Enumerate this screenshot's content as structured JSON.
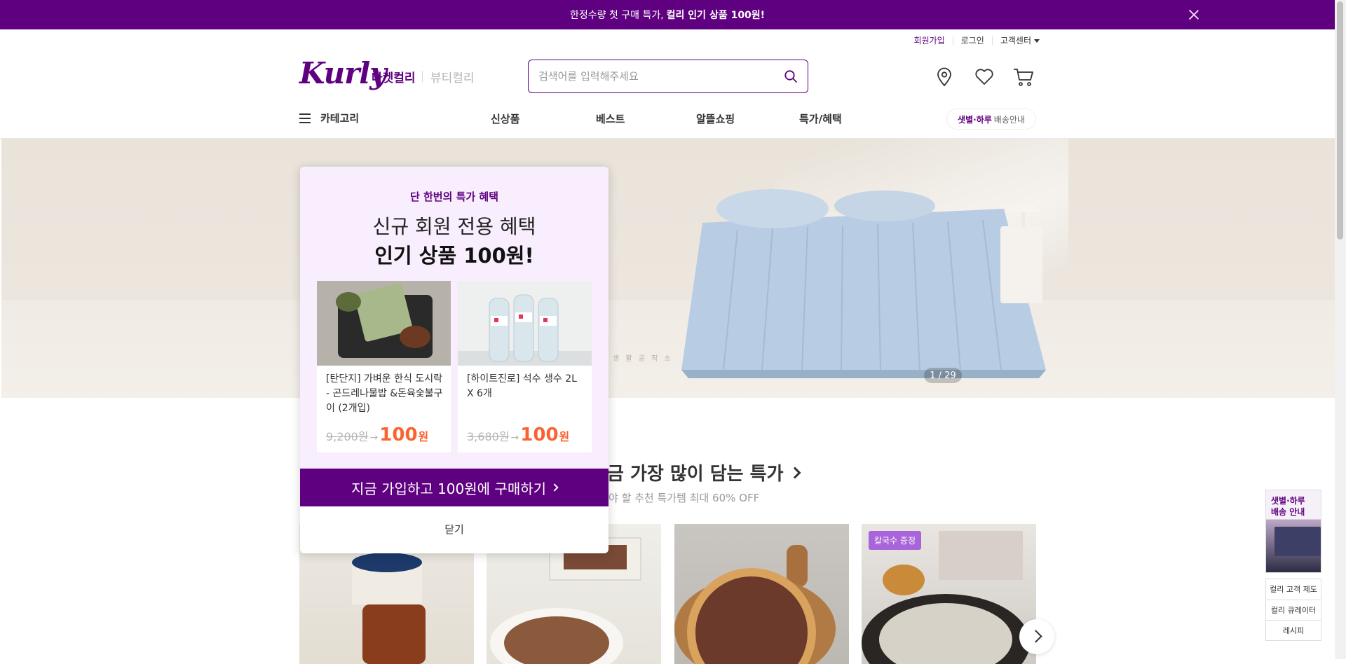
{
  "topbar": {
    "text": "한정수량 첫 구매 특가,",
    "bold": "컬리 인기 상품 100원!"
  },
  "usermenu": {
    "signup": "회원가입",
    "login": "로그인",
    "support": "고객센터"
  },
  "header": {
    "logo": "Kurly",
    "tab_market": "마켓컬리",
    "tab_beauty": "뷰티컬리",
    "search_placeholder": "검색어를 입력해주세요"
  },
  "gnb": {
    "category": "카테고리",
    "items": [
      "신상품",
      "베스트",
      "알뜰쇼핑",
      "특가/혜택"
    ],
    "delivery_bold": "샛별·하루",
    "delivery_rest": "배송안내"
  },
  "hero": {
    "counter": "1 / 29",
    "stamp": "생 활 공 작 소"
  },
  "section": {
    "title": "금 가장 많이 담는 특가",
    "subtitle": "야 할 추천 특가템 최대 60% OFF",
    "badge": "칼국수 증정"
  },
  "side": {
    "ad_text": "샛별·하루\n배송 안내",
    "menu": [
      "컬리 고객 제도",
      "컬리 큐레이터",
      "레시피"
    ]
  },
  "popup": {
    "kicker": "단 한번의 특가 혜택",
    "headline": "신규 회원 전용 혜택",
    "headline_bold": "인기 상품 100원!",
    "products": [
      {
        "name": "[탄단지] 가벼운 한식 도시락 - 곤드레나물밥 &돈육숯불구이 (2개입)",
        "original": "9,200원",
        "price": "100",
        "unit": "원"
      },
      {
        "name": "[하이트진로] 석수 생수 2L X 6개",
        "original": "3,680원",
        "price": "100",
        "unit": "원"
      }
    ],
    "cta": "지금 가입하고 100원에 구매하기",
    "close": "닫기"
  },
  "colors": {
    "brand": "#5f0080",
    "price": "#fa622f",
    "popup_bg": "#f8eefd"
  },
  "icons": [
    "close-icon",
    "search-icon",
    "location-pin-icon",
    "heart-icon",
    "cart-icon",
    "hamburger-icon",
    "chevron-right-icon"
  ]
}
